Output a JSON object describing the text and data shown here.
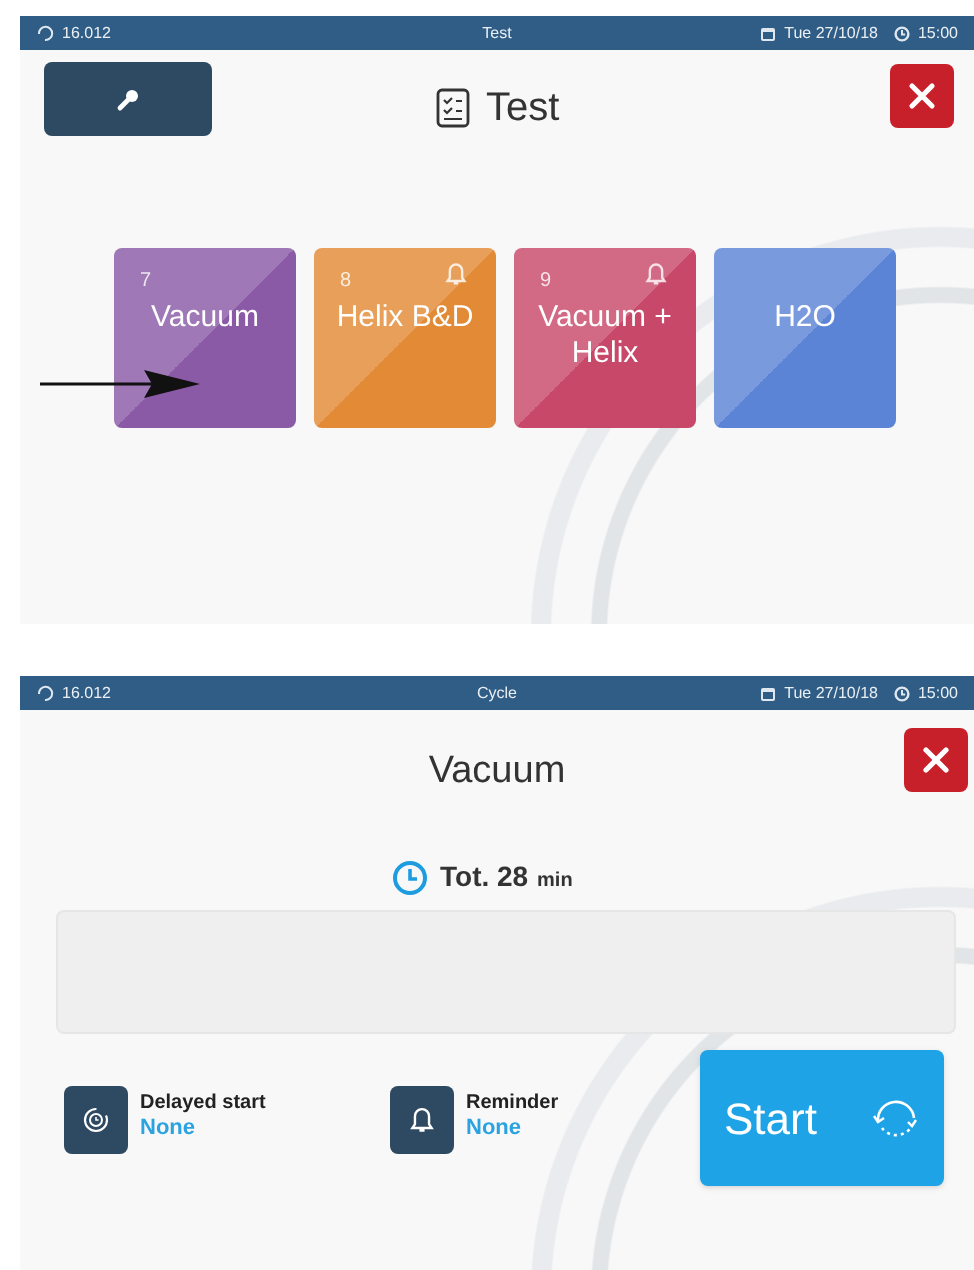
{
  "test_screen": {
    "status_bar": {
      "counter": "16.012",
      "title": "Test",
      "date": "Tue 27/10/18",
      "time": "15:00"
    },
    "title": "Test",
    "tiles": [
      {
        "number": "7",
        "label": "Vacuum",
        "bell": false,
        "color": "#8a5aa6"
      },
      {
        "number": "8",
        "label": "Helix B&D",
        "bell": true,
        "color": "#e28a35"
      },
      {
        "number": "9",
        "label": "Vacuum + Helix",
        "bell": true,
        "color": "#c8486a"
      },
      {
        "label": "H2O",
        "bell": false,
        "color": "#5b84d6"
      }
    ]
  },
  "cycle_screen": {
    "status_bar": {
      "counter": "16.012",
      "title": "Cycle",
      "date": "Tue 27/10/18",
      "time": "15:00"
    },
    "title": "Vacuum",
    "total": {
      "label": "Tot. 28",
      "unit": "min"
    },
    "options": [
      {
        "kind": "delayed",
        "label": "Delayed start",
        "value": "None"
      },
      {
        "kind": "reminder",
        "label": "Reminder",
        "value": "None"
      }
    ],
    "start_button": "Start"
  }
}
